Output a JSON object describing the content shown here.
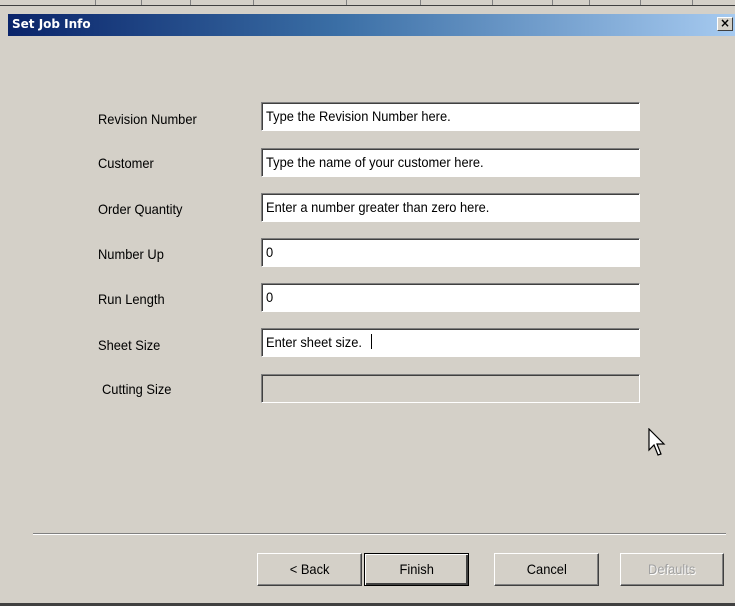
{
  "window": {
    "title": "Set Job Info",
    "close_glyph": "×"
  },
  "fields": [
    {
      "label": "Revision Number",
      "value": "Type the Revision Number here."
    },
    {
      "label": "Customer",
      "value": "Type the name of your customer here."
    },
    {
      "label": "Order Quantity",
      "value": "Enter a number greater than zero here."
    },
    {
      "label": "Number Up",
      "value": "0"
    },
    {
      "label": "Run Length",
      "value": "0"
    },
    {
      "label": "Sheet Size",
      "value": "Enter sheet size."
    },
    {
      "label": "Cutting Size",
      "value": ""
    }
  ],
  "buttons": {
    "back": "< Back",
    "finish": "Finish",
    "cancel": "Cancel",
    "defaults": "Defaults"
  },
  "icons": {
    "cursor": "arrow-cursor-icon"
  }
}
